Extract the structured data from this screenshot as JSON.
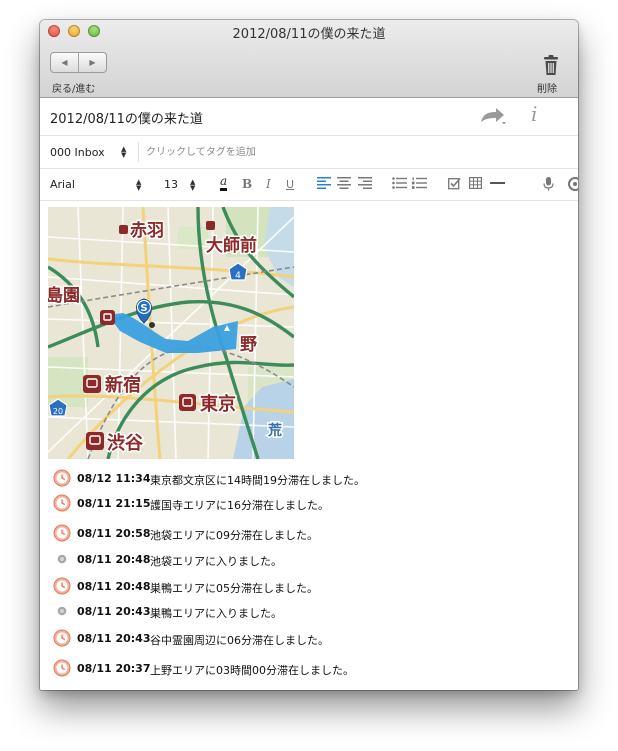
{
  "window": {
    "title": "2012/08/11の僕の来た道"
  },
  "toolbar": {
    "back_forward_label": "戻る/進む",
    "delete_label": "削除"
  },
  "note": {
    "title": "2012/08/11の僕の来た道"
  },
  "tags": {
    "notebook": "000 Inbox",
    "placeholder": "クリックしてタグを追加"
  },
  "format": {
    "font": "Arial",
    "size": "13",
    "bold": "B",
    "italic": "I",
    "underline": "U",
    "color": "a"
  },
  "map": {
    "labels": [
      "赤羽",
      "大師前",
      "島園",
      "野",
      "新宿",
      "東京",
      "渋谷",
      "荒"
    ],
    "route_badges": [
      "4",
      "20"
    ],
    "marker": "S",
    "route_color": "#3aa0e0",
    "station_color": "#8c2a2a"
  },
  "entries": [
    {
      "time": "08/12 11:34",
      "text": "東京都文京区に14時間19分滞在しました。",
      "icon": "clock-icon"
    },
    {
      "time": "08/11 21:15",
      "text": "護国寺エリアに16分滞在しました。",
      "icon": "clock-icon"
    },
    {
      "time": "08/11 20:58",
      "text": "池袋エリアに09分滞在しました。",
      "icon": "clock-icon"
    },
    {
      "time": "08/11 20:48",
      "text": "池袋エリアに入りました。",
      "icon": "dot-icon"
    },
    {
      "time": "08/11 20:48",
      "text": "巣鴨エリアに05分滞在しました。",
      "icon": "clock-icon"
    },
    {
      "time": "08/11 20:43",
      "text": "巣鴨エリアに入りました。",
      "icon": "dot-icon"
    },
    {
      "time": "08/11 20:43",
      "text": "谷中霊園周辺に06分滞在しました。",
      "icon": "clock-icon"
    },
    {
      "time": "08/11 20:37",
      "text": "上野エリアに03時間00分滞在しました。",
      "icon": "clock-icon"
    }
  ]
}
